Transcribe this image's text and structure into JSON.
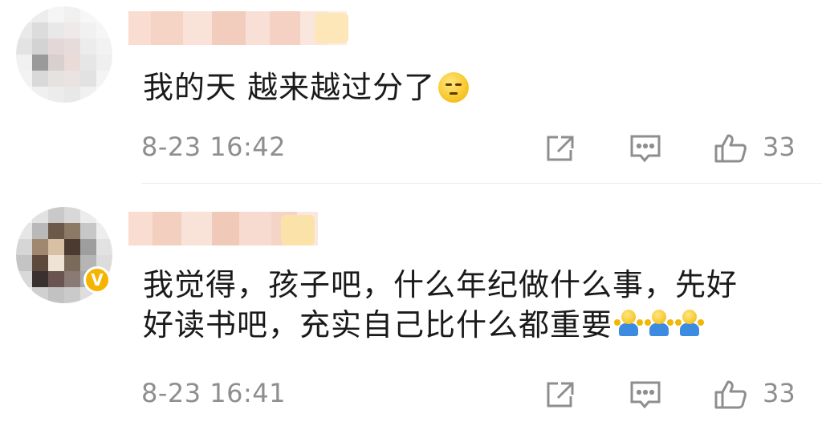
{
  "comments": [
    {
      "text": "我的天 越来越过分了",
      "emoji": "smirk-face-emoji",
      "time": "8-23 16:42",
      "likes": "33"
    },
    {
      "text_line1": "我觉得，孩子吧，什么年纪做什么事，先好",
      "text_line2": "好读书吧，充实自己比什么都重要",
      "emoji": "shrug-emoji",
      "verified_mark": "V",
      "time": "8-23 16:41",
      "likes": "33"
    }
  ],
  "colors": {
    "text": "#1a1a1a",
    "meta": "#8e8e8e",
    "divider": "#ececec",
    "badge_gold": "#f6b400"
  }
}
